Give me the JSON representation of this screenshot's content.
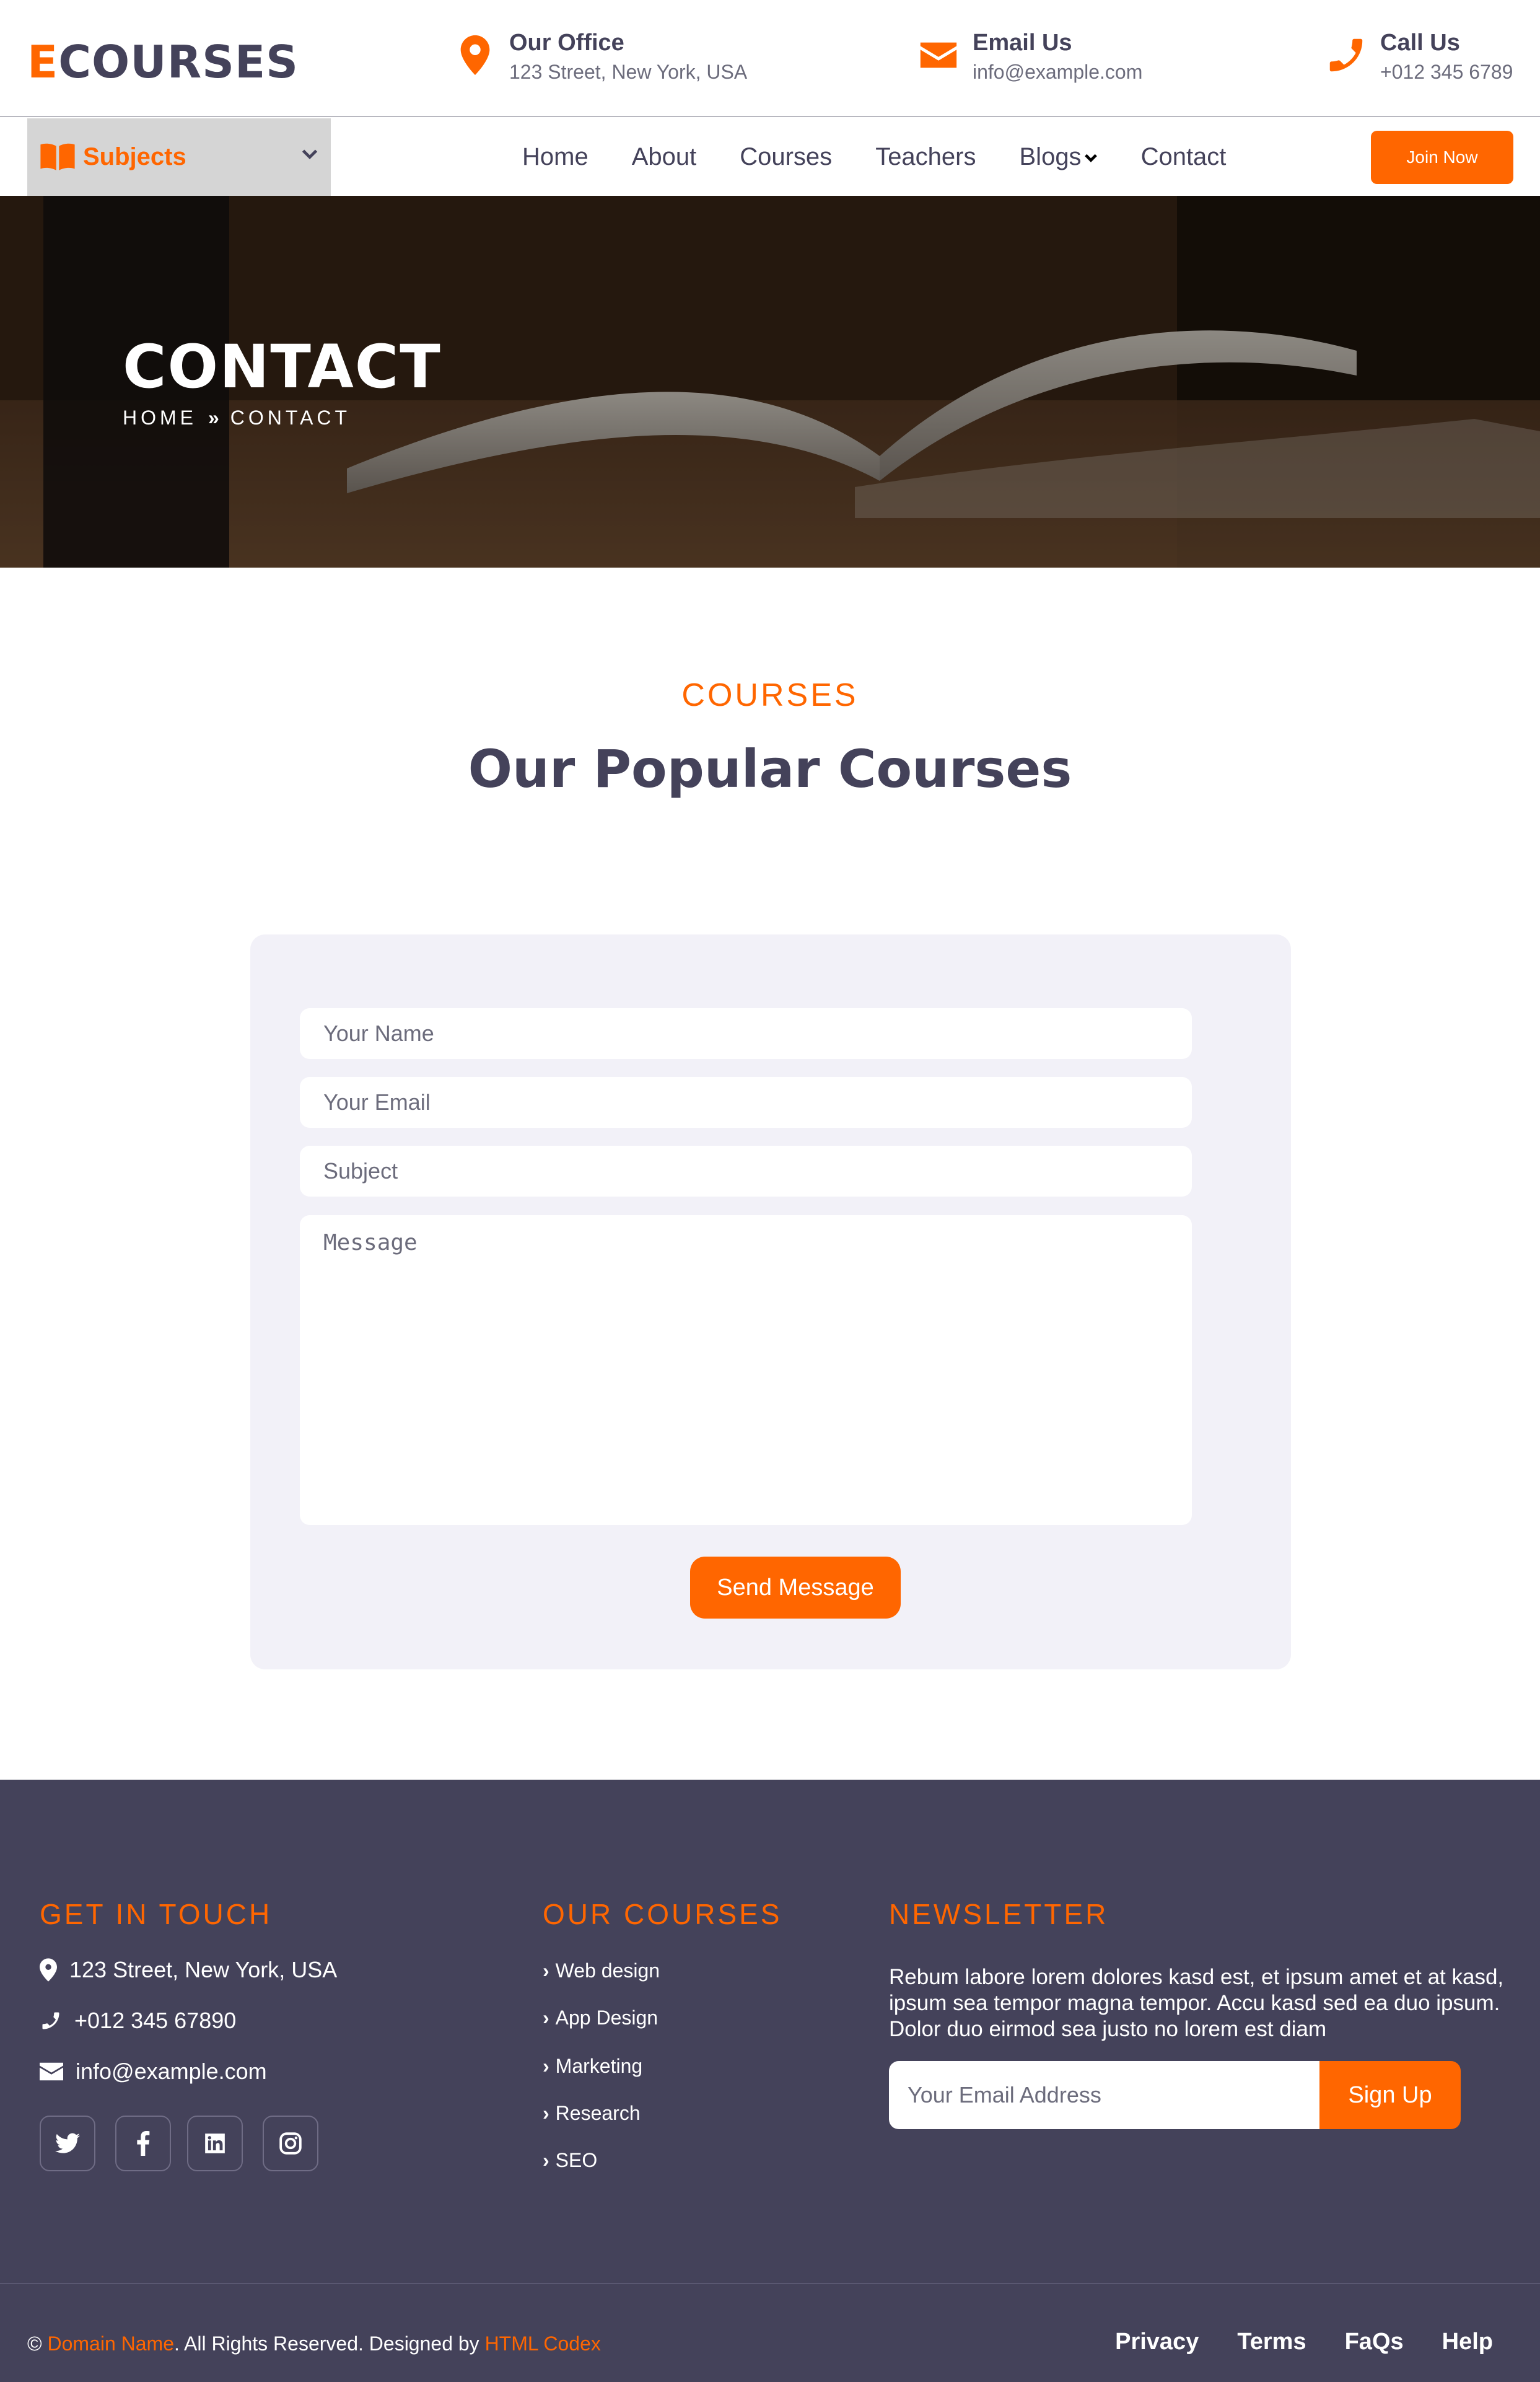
{
  "brand": {
    "first_letter": "E",
    "rest": "COURSES"
  },
  "topbar": {
    "office": {
      "title": "Our Office",
      "value": "123 Street, New York, USA"
    },
    "email": {
      "title": "Email Us",
      "value": "info@example.com"
    },
    "call": {
      "title": "Call Us",
      "value": "+012 345 6789"
    }
  },
  "nav": {
    "subjects_label": "Subjects",
    "items": [
      "Home",
      "About",
      "Courses",
      "Teachers",
      "Blogs",
      "Contact"
    ],
    "join_label": "Join Now"
  },
  "hero": {
    "title": "CONTACT",
    "crumb_home": "HOME",
    "crumb_sep": "»",
    "crumb_current": "CONTACT"
  },
  "section": {
    "subtitle": "COURSES",
    "title": "Our Popular Courses"
  },
  "form": {
    "name_placeholder": "Your Name",
    "email_placeholder": "Your Email",
    "subject_placeholder": "Subject",
    "message_placeholder": "Message",
    "send_label": "Send Message"
  },
  "footer": {
    "get_in_touch": {
      "heading": "GET IN TOUCH",
      "address": "123 Street, New York, USA",
      "phone": "+012 345 67890",
      "email": "info@example.com"
    },
    "courses": {
      "heading": "OUR COURSES",
      "items": [
        "Web design",
        "App Design",
        "Marketing",
        "Research",
        "SEO"
      ]
    },
    "newsletter": {
      "heading": "NEWSLETTER",
      "text": "Rebum labore lorem dolores kasd est, et ipsum amet et at kasd, ipsum sea tempor magna tempor. Accu kasd sed ea duo ipsum. Dolor duo eirmod sea justo no lorem est diam",
      "placeholder": "Your Email Address",
      "button": "Sign Up"
    },
    "copyright": {
      "symbol": "©",
      "domain": "Domain Name",
      "middle": ". All Rights Reserved. Designed by",
      "designer": "HTML Codex"
    },
    "bottom_links": [
      "Privacy",
      "Terms",
      "FaQs",
      "Help"
    ]
  },
  "colors": {
    "accent": "#ff6600",
    "dark": "#44425a",
    "card_bg": "#f2f1f8"
  }
}
